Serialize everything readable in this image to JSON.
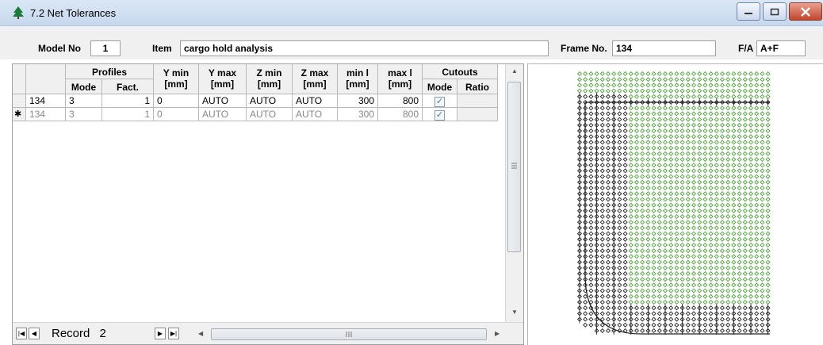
{
  "window": {
    "title": "7.2 Net Tolerances",
    "icon": "tree-icon",
    "accent": "#1a7a3a"
  },
  "header": {
    "model_no_label": "Model No",
    "model_no_value": "1",
    "item_label": "Item",
    "item_value": "cargo hold analysis",
    "frame_label": "Frame No.",
    "frame_value": "134",
    "fa_label": "F/A",
    "fa_value": "A+F"
  },
  "table": {
    "group_headers": {
      "profiles": "Profiles",
      "cutouts": "Cutouts"
    },
    "columns": {
      "mode": "Mode",
      "fact": "Fact.",
      "ymin": "Y min",
      "ymin_unit": "[mm]",
      "ymax": "Y max",
      "ymax_unit": "[mm]",
      "zmin": "Z min",
      "zmin_unit": "[mm]",
      "zmax": "Z max",
      "zmax_unit": "[mm]",
      "minl": "min l",
      "minl_unit": "[mm]",
      "maxl": "max l",
      "maxl_unit": "[mm]",
      "cmode": "Mode",
      "ratio": "Ratio"
    },
    "rows": [
      {
        "marker": "",
        "frame": "134",
        "mode": "3",
        "fact": "1",
        "ymin": "0",
        "ymax": "AUTO",
        "zmin": "AUTO",
        "zmax": "AUTO",
        "minl": "300",
        "maxl": "800",
        "cutout_mode": "✓",
        "ratio": ""
      },
      {
        "marker": "✱",
        "frame": "134",
        "mode": "3",
        "fact": "1",
        "ymin": "0",
        "ymax": "AUTO",
        "zmin": "AUTO",
        "zmax": "AUTO",
        "minl": "300",
        "maxl": "800",
        "cutout_mode": "✓",
        "ratio": ""
      }
    ]
  },
  "navigator": {
    "record_label": "Record",
    "record_value": "2"
  },
  "colors": {
    "node_green": "#4aa534",
    "line_dark": "#222222"
  }
}
